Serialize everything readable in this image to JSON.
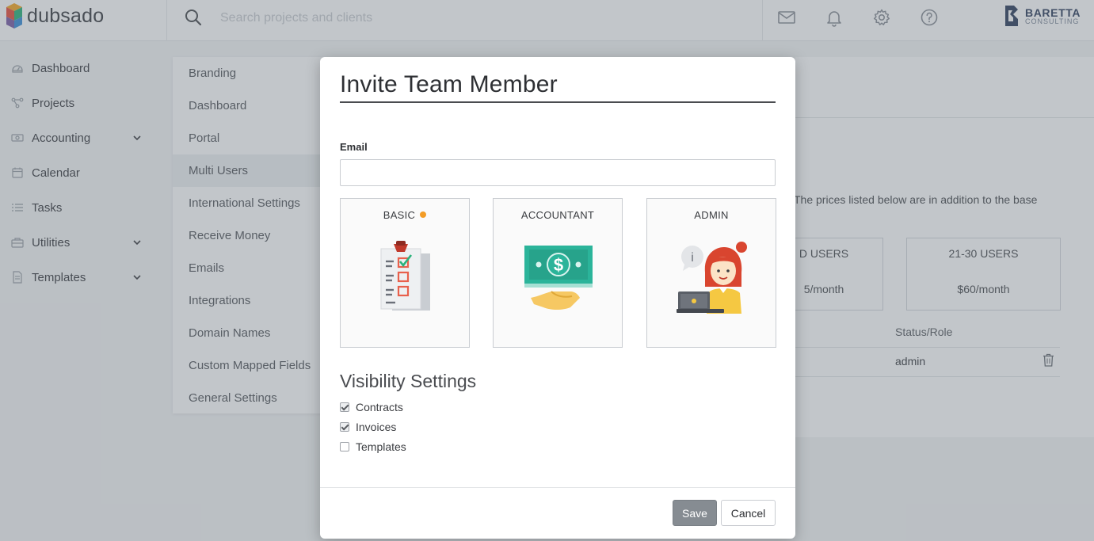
{
  "app": {
    "logo_text": "dubsado",
    "search_placeholder": "Search projects and clients",
    "top_icons": [
      "mail-icon",
      "bell-icon",
      "gear-icon",
      "help-icon"
    ],
    "brand": {
      "name": "BARETTA",
      "sub": "CONSULTING"
    }
  },
  "sidebar": {
    "items": [
      {
        "label": "Dashboard",
        "icon": "dashboard-icon",
        "has_chevron": false
      },
      {
        "label": "Projects",
        "icon": "projects-icon",
        "has_chevron": false
      },
      {
        "label": "Accounting",
        "icon": "accounting-icon",
        "has_chevron": true
      },
      {
        "label": "Calendar",
        "icon": "calendar-icon",
        "has_chevron": false
      },
      {
        "label": "Tasks",
        "icon": "tasks-icon",
        "has_chevron": false
      },
      {
        "label": "Utilities",
        "icon": "utilities-icon",
        "has_chevron": true
      },
      {
        "label": "Templates",
        "icon": "templates-icon",
        "has_chevron": true
      }
    ]
  },
  "settings_menu": {
    "items": [
      "Branding",
      "Dashboard",
      "Portal",
      "Multi Users",
      "International Settings",
      "Receive Money",
      "Emails",
      "Integrations",
      "Domain Names",
      "Custom Mapped Fields",
      "General Settings"
    ],
    "active": "Multi Users"
  },
  "background": {
    "prices_text": "The prices listed below are in addition to the base",
    "tiers": [
      {
        "title": "D USERS",
        "price": "5/month"
      },
      {
        "title": "21-30 USERS",
        "price": "$60/month"
      }
    ],
    "status_header": "Status/Role",
    "role_value": "admin"
  },
  "modal": {
    "title": "Invite Team Member",
    "email_label": "Email",
    "email_value": "",
    "roles": [
      {
        "label": "BASIC",
        "selected": true,
        "icon": "clipboard-checklist-icon"
      },
      {
        "label": "ACCOUNTANT",
        "selected": false,
        "icon": "money-hand-icon"
      },
      {
        "label": "ADMIN",
        "selected": false,
        "icon": "admin-person-laptop-icon"
      }
    ],
    "visibility_title": "Visibility Settings",
    "visibility": [
      {
        "label": "Contracts",
        "checked": true
      },
      {
        "label": "Invoices",
        "checked": true
      },
      {
        "label": "Templates",
        "checked": false
      }
    ],
    "save_label": "Save",
    "cancel_label": "Cancel",
    "colors": {
      "accent_dot": "#f39c26",
      "save_bg": "#868c92"
    }
  }
}
